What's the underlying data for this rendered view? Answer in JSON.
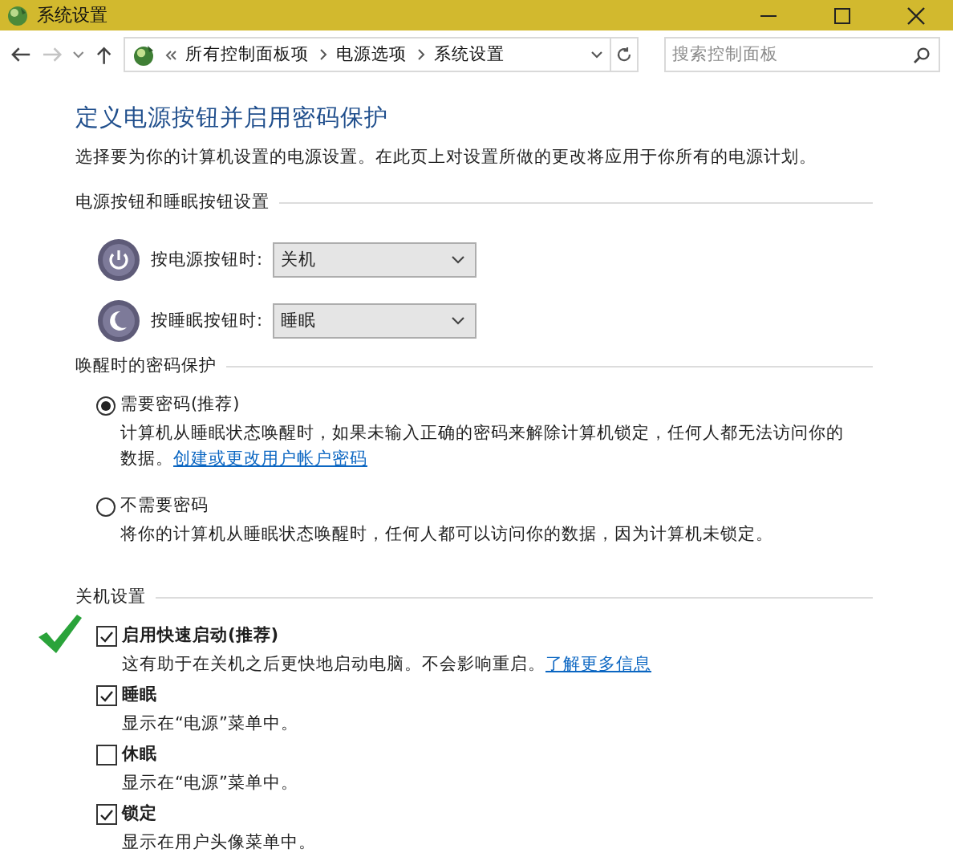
{
  "window": {
    "title": "系统设置"
  },
  "address_bar": {
    "path": [
      "所有控制面板项",
      "电源选项",
      "系统设置"
    ],
    "search": {
      "placeholder": "搜索控制面板"
    }
  },
  "heading": "定义电源按钮并启用密码保护",
  "description": "选择要为你的计算机设置的电源设置。在此页上对设置所做的更改将应用于你所有的电源计划。",
  "sections": [
    {
      "title": "电源按钮和睡眠按钮设置",
      "kind": "buttons",
      "items": [
        {
          "kind": "power",
          "label": "按电源按钮时:",
          "value": "关机"
        },
        {
          "kind": "sleep",
          "label": "按睡眠按钮时:",
          "value": "睡眠"
        }
      ]
    },
    {
      "title": "唤醒时的密码保护",
      "kind": "radios",
      "items": [
        {
          "label": "需要密码(推荐)",
          "description": "计算机从睡眠状态唤醒时，如果未输入正确的密码来解除计算机锁定，任何人都无法访问你的数据。",
          "link": "创建或更改用户帐户密码",
          "selected": true
        },
        {
          "label": "不需要密码",
          "description": "将你的计算机从睡眠状态唤醒时，任何人都可以访问你的数据，因为计算机未锁定。",
          "selected": false
        }
      ]
    },
    {
      "title": "关机设置",
      "kind": "checks",
      "items": [
        {
          "label": "启用快速启动(推荐)",
          "description": "这有助于在关机之后更快地启动电脑。不会影响重启。",
          "link": "了解更多信息",
          "checked": true
        },
        {
          "label": "睡眠",
          "description": "显示在“电源”菜单中。",
          "checked": true
        },
        {
          "label": "休眠",
          "description": "显示在“电源”菜单中。",
          "checked": false
        },
        {
          "label": "锁定",
          "description": "显示在用户头像菜单中。",
          "checked": true
        }
      ]
    }
  ]
}
